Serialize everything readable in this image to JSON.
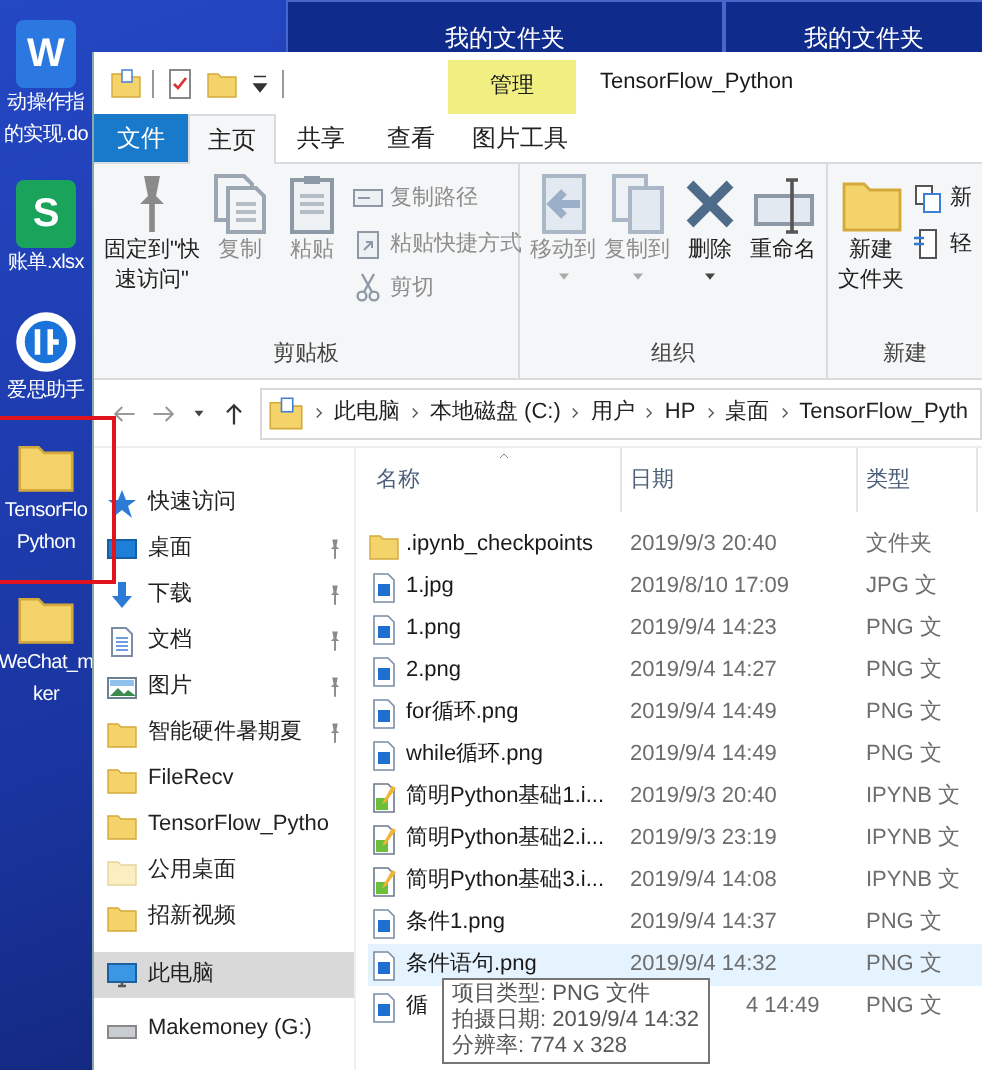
{
  "background_windows": [
    {
      "title": "我的文件夹"
    },
    {
      "title": "我的文件夹"
    }
  ],
  "desktop_icons": [
    {
      "kind": "word",
      "glyph": "W",
      "label_lines": [
        "动操作指",
        "的实现.do"
      ],
      "highlighted": false
    },
    {
      "kind": "sheet",
      "glyph": "S",
      "label_lines": [
        "账单.xlsx"
      ],
      "highlighted": false
    },
    {
      "kind": "app",
      "label_lines": [
        "爱思助手"
      ],
      "highlighted": false
    },
    {
      "kind": "folder",
      "label_lines": [
        "TensorFlo",
        "Python"
      ],
      "highlighted": true
    },
    {
      "kind": "folder",
      "label_lines": [
        "WeChat_m",
        "ker"
      ],
      "highlighted": false
    }
  ],
  "explorer": {
    "context_group": "管理",
    "title": "TensorFlow_Python",
    "tabs": [
      {
        "label": "文件",
        "kind": "file",
        "selected": false
      },
      {
        "label": "主页",
        "kind": "tab",
        "selected": true
      },
      {
        "label": "共享",
        "kind": "tab",
        "selected": false
      },
      {
        "label": "查看",
        "kind": "tab",
        "selected": false
      },
      {
        "label": "图片工具",
        "kind": "context",
        "selected": false
      }
    ],
    "ribbon_groups": [
      {
        "label": "剪贴板",
        "large": [
          {
            "kind": "pin",
            "label_lines": [
              "固定到\"快",
              "速访问\""
            ],
            "disabled": false,
            "dropdown": false
          },
          {
            "kind": "copy",
            "label_lines": [
              "复制"
            ],
            "disabled": true,
            "dropdown": false
          },
          {
            "kind": "paste",
            "label_lines": [
              "粘贴"
            ],
            "disabled": true,
            "dropdown": false
          }
        ],
        "small": [
          {
            "kind": "copypath",
            "label": "复制路径",
            "disabled": true
          },
          {
            "kind": "shortcut",
            "label": "粘贴快捷方式",
            "disabled": true
          },
          {
            "kind": "cut",
            "label": "剪切",
            "disabled": true
          }
        ]
      },
      {
        "label": "组织",
        "large": [
          {
            "kind": "moveto",
            "label_lines": [
              "移动到"
            ],
            "disabled": true,
            "dropdown": true
          },
          {
            "kind": "copyto",
            "label_lines": [
              "复制到"
            ],
            "disabled": true,
            "dropdown": true
          },
          {
            "kind": "delete",
            "label_lines": [
              "删除"
            ],
            "disabled": false,
            "dropdown": true
          },
          {
            "kind": "rename",
            "label_lines": [
              "重命名"
            ],
            "disabled": false,
            "dropdown": false
          }
        ]
      },
      {
        "label": "新建",
        "large": [
          {
            "kind": "newfolder",
            "label_lines": [
              "新建",
              "文件夹"
            ],
            "disabled": false,
            "dropdown": false
          }
        ],
        "small": [
          {
            "kind": "newitem",
            "label": "新",
            "disabled": false
          },
          {
            "kind": "easy",
            "label": "轻",
            "disabled": false
          }
        ]
      }
    ],
    "breadcrumbs": [
      "此电脑",
      "本地磁盘 (C:)",
      "用户",
      "HP",
      "桌面",
      "TensorFlow_Pyth"
    ],
    "nav_items": [
      {
        "kind": "quick",
        "label": "快速访问",
        "pinned": false,
        "selected": false
      },
      {
        "kind": "desktop",
        "label": "桌面",
        "pinned": true,
        "selected": false
      },
      {
        "kind": "download",
        "label": "下载",
        "pinned": true,
        "selected": false
      },
      {
        "kind": "document",
        "label": "文档",
        "pinned": true,
        "selected": false
      },
      {
        "kind": "pictures",
        "label": "图片",
        "pinned": true,
        "selected": false
      },
      {
        "kind": "folder",
        "label": "智能硬件暑期夏",
        "pinned": true,
        "selected": false
      },
      {
        "kind": "folder",
        "label": "FileRecv",
        "pinned": false,
        "selected": false
      },
      {
        "kind": "folder",
        "label": "TensorFlow_Pytho",
        "pinned": false,
        "selected": false
      },
      {
        "kind": "public",
        "label": "公用桌面",
        "pinned": false,
        "selected": false
      },
      {
        "kind": "folder",
        "label": "招新视频",
        "pinned": false,
        "selected": false
      },
      {
        "kind": "pc",
        "label": "此电脑",
        "pinned": false,
        "selected": true
      },
      {
        "kind": "drive",
        "label": "Makemoney (G:)",
        "pinned": false,
        "selected": false
      }
    ],
    "columns": [
      "名称",
      "日期",
      "类型"
    ],
    "files": [
      {
        "kind": "folder",
        "name": ".ipynb_checkpoints",
        "date": "2019/9/3 20:40",
        "type": "文件夹",
        "selected": false
      },
      {
        "kind": "image",
        "name": "1.jpg",
        "date": "2019/8/10 17:09",
        "type": "JPG 文",
        "selected": false
      },
      {
        "kind": "image",
        "name": "1.png",
        "date": "2019/9/4 14:23",
        "type": "PNG 文",
        "selected": false
      },
      {
        "kind": "image",
        "name": "2.png",
        "date": "2019/9/4 14:27",
        "type": "PNG 文",
        "selected": false
      },
      {
        "kind": "image",
        "name": "for循环.png",
        "date": "2019/9/4 14:49",
        "type": "PNG 文",
        "selected": false
      },
      {
        "kind": "image",
        "name": "while循环.png",
        "date": "2019/9/4 14:49",
        "type": "PNG 文",
        "selected": false
      },
      {
        "kind": "notebook",
        "name": "简明Python基础1.i...",
        "date": "2019/9/3 20:40",
        "type": "IPYNB 文",
        "selected": false
      },
      {
        "kind": "notebook",
        "name": "简明Python基础2.i...",
        "date": "2019/9/3 23:19",
        "type": "IPYNB 文",
        "selected": false
      },
      {
        "kind": "notebook",
        "name": "简明Python基础3.i...",
        "date": "2019/9/4 14:08",
        "type": "IPYNB 文",
        "selected": false
      },
      {
        "kind": "image",
        "name": "条件1.png",
        "date": "2019/9/4 14:37",
        "type": "PNG 文",
        "selected": false
      },
      {
        "kind": "image",
        "name": "条件语句.png",
        "date": "2019/9/4 14:32",
        "type": "PNG 文",
        "selected": true
      },
      {
        "kind": "image",
        "name": "循",
        "date": "4 14:49",
        "type": "PNG 文",
        "selected": false,
        "under_tooltip": true
      }
    ],
    "tooltip": [
      "项目类型: PNG 文件",
      "拍摄日期: 2019/9/4 14:32",
      "分辨率: 774 x 328"
    ]
  }
}
